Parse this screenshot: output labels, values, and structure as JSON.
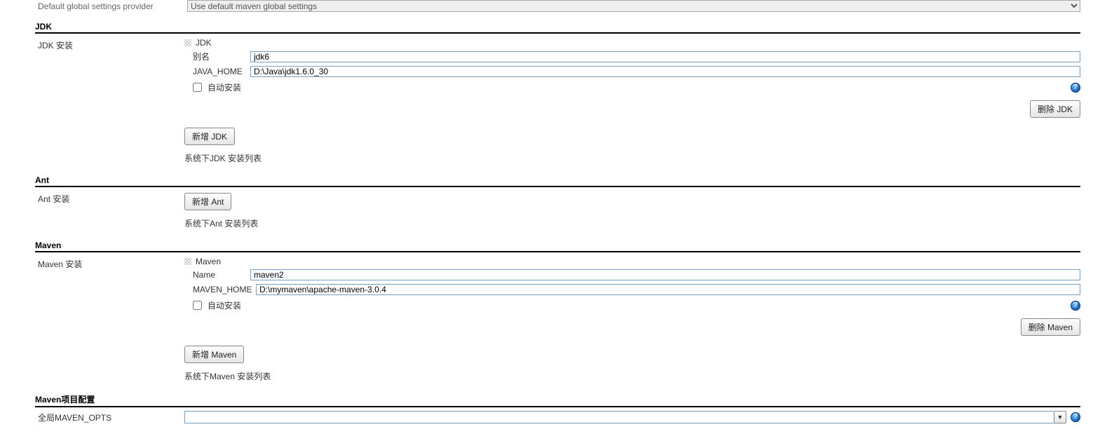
{
  "top": {
    "label": "Default global settings provider",
    "select_value": "Use default maven global settings"
  },
  "jdk": {
    "section_title": "JDK",
    "row_label": "JDK 安装",
    "block_title": "JDK",
    "alias_label": "别名",
    "alias_value": "jdk6",
    "home_label": "JAVA_HOME",
    "home_value": "D:\\Java\\jdk1.6.0_30",
    "auto_install_label": "自动安装",
    "auto_install_checked": false,
    "delete_label": "删除 JDK",
    "add_label": "新增 JDK",
    "hint": "系统下JDK 安装列表"
  },
  "ant": {
    "section_title": "Ant",
    "row_label": "Ant 安装",
    "add_label": "新增 Ant",
    "hint": "系统下Ant 安装列表"
  },
  "maven": {
    "section_title": "Maven",
    "row_label": "Maven 安装",
    "block_title": "Maven",
    "name_label": "Name",
    "name_value": "maven2",
    "home_label": "MAVEN_HOME",
    "home_value": "D:\\mymaven\\apache-maven-3.0.4",
    "auto_install_label": "自动安装",
    "auto_install_checked": false,
    "delete_label": "删除 Maven",
    "add_label": "新增 Maven",
    "hint": "系统下Maven 安装列表"
  },
  "maven_project": {
    "section_title": "Maven项目配置",
    "opts_label": "全局MAVEN_OPTS",
    "opts_value": ""
  },
  "icons": {
    "help_glyph": "?",
    "caret_glyph": "▼"
  }
}
